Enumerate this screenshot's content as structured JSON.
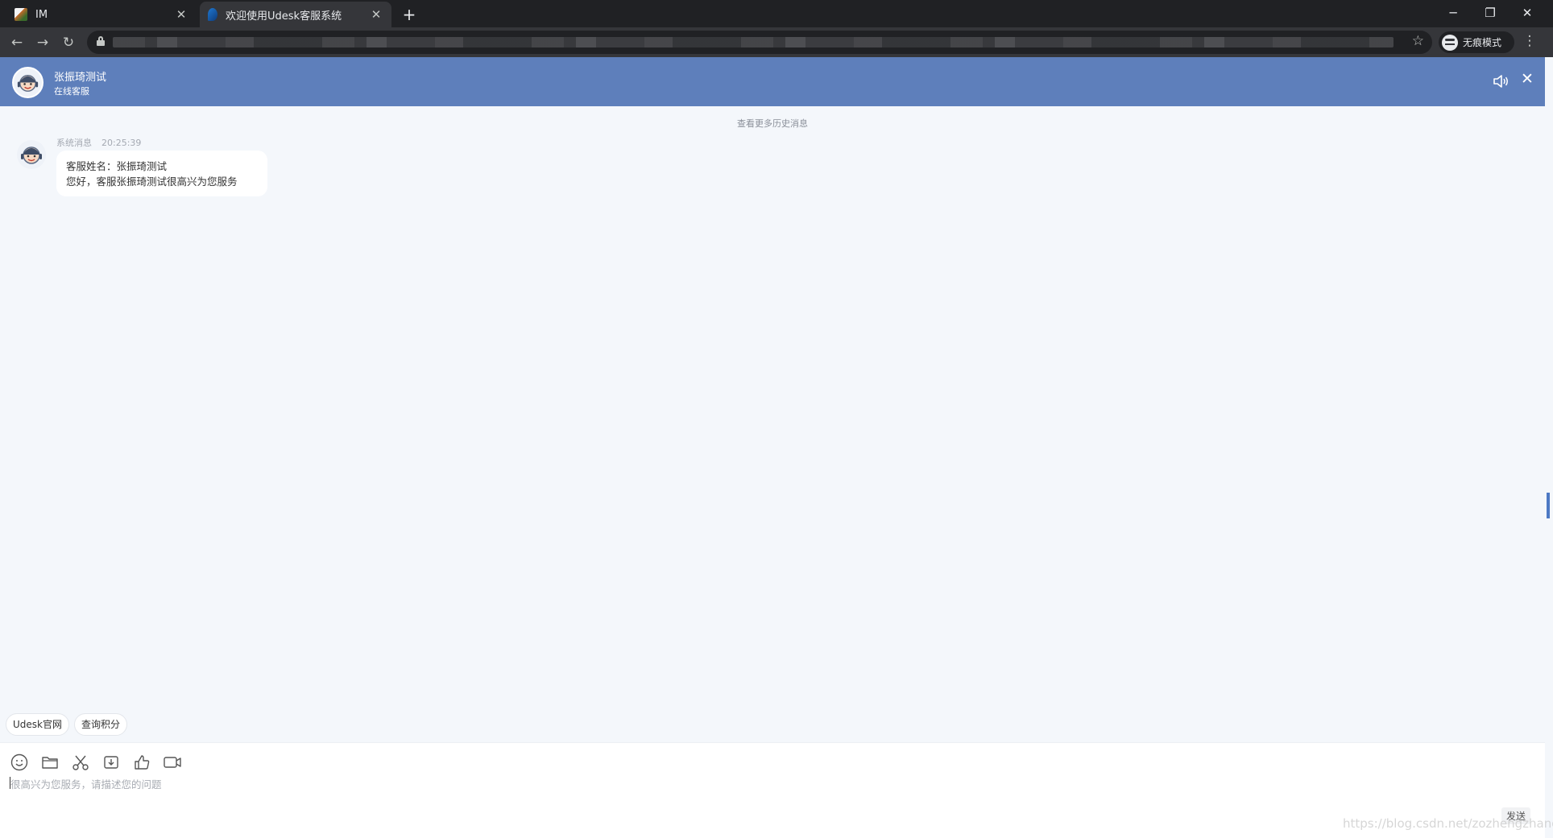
{
  "browser": {
    "tabs": [
      {
        "title": "IM",
        "favicon": "im-favicon-icon",
        "active": false
      },
      {
        "title": "欢迎使用Udesk客服系统",
        "favicon": "udesk-favicon-icon",
        "active": true
      }
    ],
    "incognito_label": "无痕模式"
  },
  "header": {
    "agent_name": "张振琦测试",
    "agent_status": "在线客服",
    "background_color": "#5e7fbb"
  },
  "messages": {
    "history_link": "查看更多历史消息",
    "items": [
      {
        "sender": "系统消息",
        "time": "20:25:39",
        "lines": [
          "客服姓名：张振琦测试",
          "您好，客服张振琦测试很高兴为您服务"
        ]
      }
    ]
  },
  "quick_buttons": [
    "Udesk官网",
    "查询积分"
  ],
  "input": {
    "tools": [
      "emoji-icon",
      "folder-icon",
      "scissors-icon",
      "download-icon",
      "thumbs-up-icon",
      "video-icon"
    ],
    "placeholder": "很高兴为您服务，请描述您的问题",
    "send_label": "发送"
  },
  "watermark": "https://blog.csdn.net/zozhengzhang"
}
